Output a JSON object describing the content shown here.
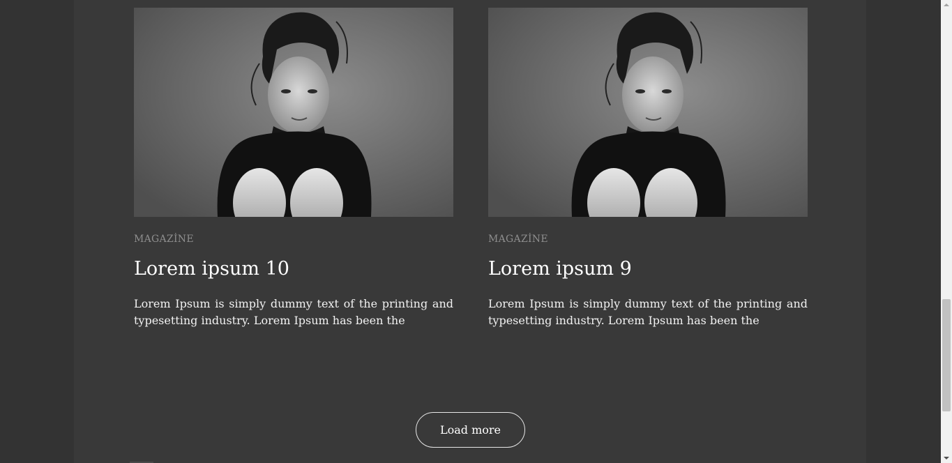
{
  "articles": [
    {
      "category": "MAGAZİNE",
      "title": "Lorem ipsum 10",
      "excerpt": "Lorem Ipsum is simply dummy text of the printing and typesetting industry. Lorem Ipsum has been the"
    },
    {
      "category": "MAGAZİNE",
      "title": "Lorem ipsum 9",
      "excerpt": "Lorem Ipsum is simply dummy text of the printing and typesetting industry. Lorem Ipsum has been the"
    }
  ],
  "load_more_label": "Load more",
  "colors": {
    "page_background": "#333333",
    "content_background": "#393939",
    "category_text": "#8e8e8e",
    "title_text": "#ffffff"
  }
}
